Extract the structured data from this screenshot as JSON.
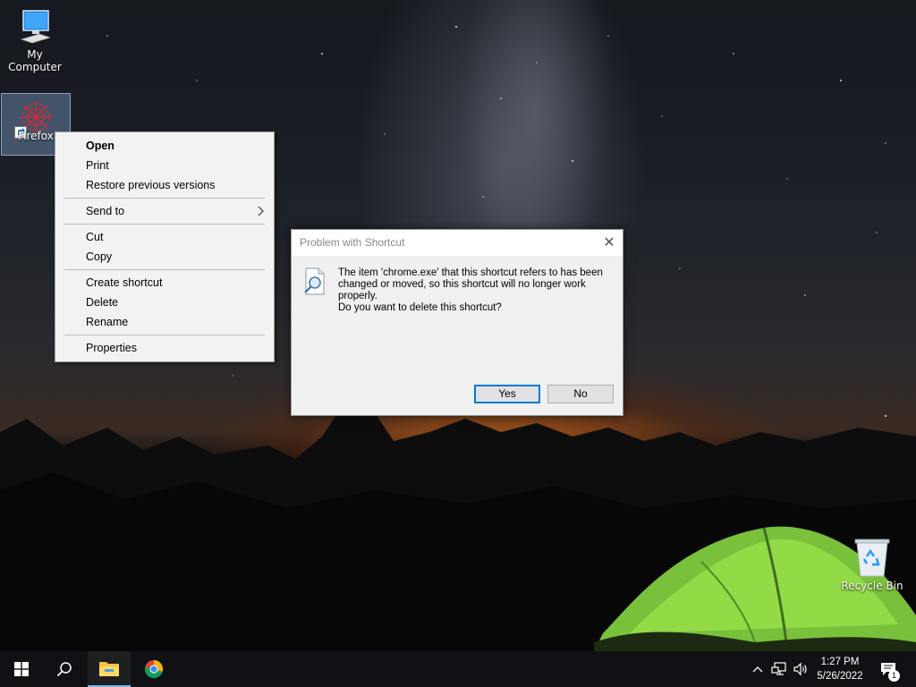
{
  "desktop": {
    "icons": [
      {
        "label": "My Computer",
        "icon": "computer-icon"
      },
      {
        "label": "Firefox",
        "icon": "firefox-icon"
      },
      {
        "label": "Recycle Bin",
        "icon": "recycle-bin-icon"
      }
    ]
  },
  "context_menu": {
    "items": [
      {
        "label": "Open",
        "bold": true
      },
      {
        "label": "Print"
      },
      {
        "label": "Restore previous versions"
      },
      {
        "label": "Send to",
        "submenu": true
      },
      {
        "label": "Cut"
      },
      {
        "label": "Copy"
      },
      {
        "label": "Create shortcut"
      },
      {
        "label": "Delete"
      },
      {
        "label": "Rename"
      },
      {
        "label": "Properties"
      }
    ]
  },
  "dialog": {
    "title": "Problem with Shortcut",
    "close_glyph": "✕",
    "message": "The item 'chrome.exe' that this shortcut refers to has been changed or moved, so this shortcut will no longer work properly.",
    "question": "Do you want to delete this shortcut?",
    "yes_label": "Yes",
    "no_label": "No"
  },
  "taskbar": {
    "pinned": [
      "start-icon",
      "search-icon",
      "file-explorer-icon",
      "chrome-icon"
    ],
    "tray_chevron": "^",
    "time": "1:27 PM",
    "date": "5/26/2022",
    "notification_count": "1"
  },
  "colors": {
    "accent": "#0078d7",
    "taskbar": "#101114",
    "menu_bg": "#f2f2f2",
    "dialog_bg": "#f0f0f0"
  }
}
